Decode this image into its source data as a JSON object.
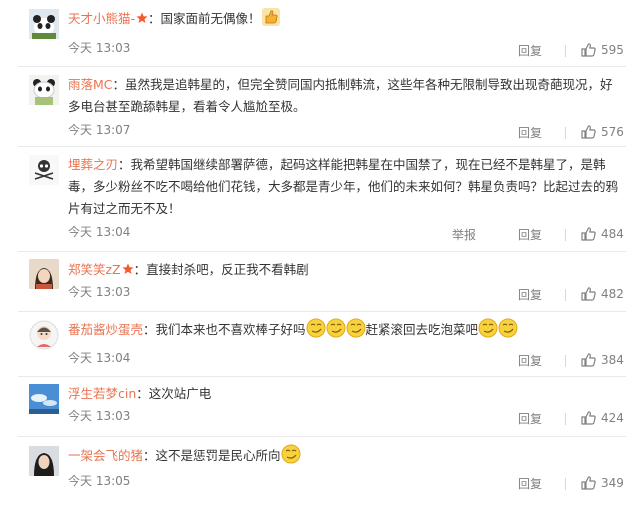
{
  "comments": [
    {
      "name": "天才小熊猫-",
      "vip": true,
      "text": "：国家面前无偶像！",
      "emoji_after": [
        "thumbs-up"
      ],
      "time": "今天 13:03",
      "report": "",
      "reply": "回复",
      "likes": "595"
    },
    {
      "name": "雨落MC",
      "vip": false,
      "text": "：虽然我是追韩星的，但完全赞同国内抵制韩流，这些年各种无限制导致出现奇葩现况，好多电台甚至跪舔韩星，看着令人尴尬至极。",
      "emoji_after": [],
      "time": "今天 13:07",
      "report": "",
      "reply": "回复",
      "likes": "576"
    },
    {
      "name": "埋葬之刃",
      "vip": false,
      "text": "：我希望韩国继续部署萨德，起码这样能把韩星在中国禁了，现在已经不是韩星了，是韩毒，多少粉丝不吃不喝给他们花钱，大多都是青少年，他们的未来如何？韩星负责吗？比起过去的鸦片有过之而无不及！",
      "emoji_after": [],
      "time": "今天 13:04",
      "report": "举报",
      "reply": "回复",
      "likes": "484"
    },
    {
      "name": "郑笑笑zZ",
      "vip": true,
      "text": "：直接封杀吧，反正我不看韩剧",
      "emoji_after": [],
      "time": "今天 13:03",
      "report": "",
      "reply": "回复",
      "likes": "482"
    },
    {
      "name": "番茄酱炒蛋壳",
      "vip": false,
      "text": "：我们本来也不喜欢棒子好吗",
      "text2": "赶紧滚回去吃泡菜吧",
      "emoji_mid": [
        "smirk-face",
        "smirk-face",
        "smirk-face"
      ],
      "emoji_after": [
        "smirk-face",
        "smirk-face"
      ],
      "time": "今天 13:04",
      "report": "",
      "reply": "回复",
      "likes": "384"
    },
    {
      "name": "浮生若梦cin",
      "vip": false,
      "text": "：这次站广电",
      "emoji_after": [],
      "time": "今天 13:03",
      "report": "",
      "reply": "回复",
      "likes": "424"
    },
    {
      "name": "一架会飞的猪",
      "vip": false,
      "text": "：这不是惩罚是民心所向",
      "emoji_after": [
        "smirk-face"
      ],
      "time": "今天 13:05",
      "report": "",
      "reply": "回复",
      "likes": "349"
    }
  ],
  "colors": {
    "username": "#eb7350",
    "meta": "#808080",
    "body": "#333333",
    "divider": "#e9e9e9"
  }
}
